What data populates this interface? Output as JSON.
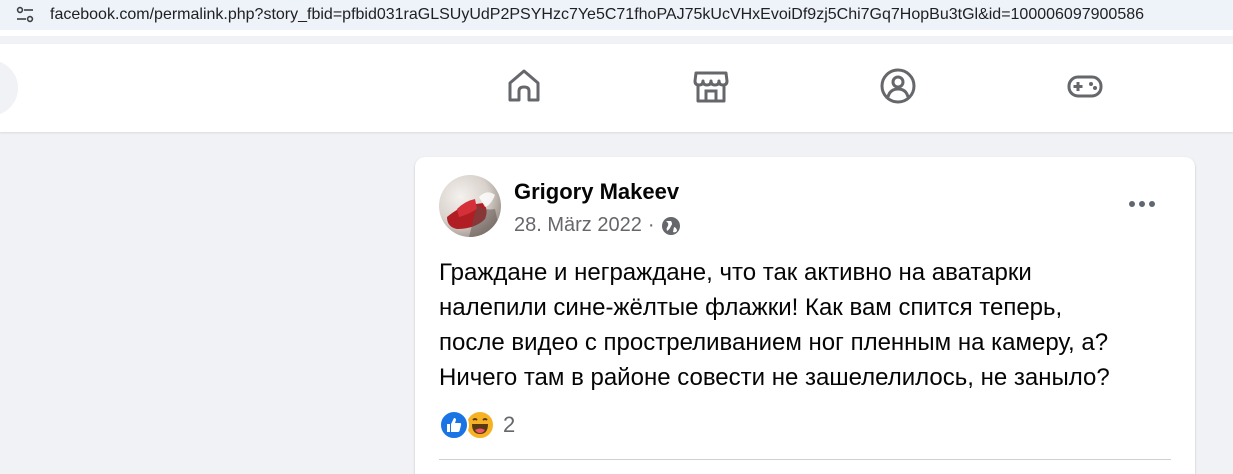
{
  "browser": {
    "url": "facebook.com/permalink.php?story_fbid=pfbid031raGLSUyUdP2PSYHzc7Ye5C71fhoPAJ75kUcVHxEvoiDf9zj5Chi7Gq7HopBu3tGl&id=100006097900586",
    "site_info_icon": "tune-icon"
  },
  "navbar": {
    "icons": [
      "home-icon",
      "marketplace-icon",
      "groups-icon",
      "gaming-icon"
    ],
    "icon_color": "#65676b"
  },
  "post": {
    "author": "Grigory Makeev",
    "date": "28. März 2022",
    "separator": "·",
    "audience_icon": "globe-icon",
    "text_lines": [
      "Граждане и неграждане, что так активно на аватарки",
      "налепили сине-жёлтые флажки! Как вам спится теперь,",
      "после видео с простреливанием ног пленным на камеру, а?",
      "Ничего там в районе совести не зашелелилось, не заныло?"
    ],
    "reactions": {
      "types": [
        "like-icon",
        "haha-icon"
      ],
      "count": "2"
    }
  },
  "colors": {
    "background": "#f0f2f5",
    "card": "#ffffff",
    "secondary_text": "#65676b",
    "like_blue": "#1b74e4",
    "haha_yellow": "#f7b125"
  }
}
